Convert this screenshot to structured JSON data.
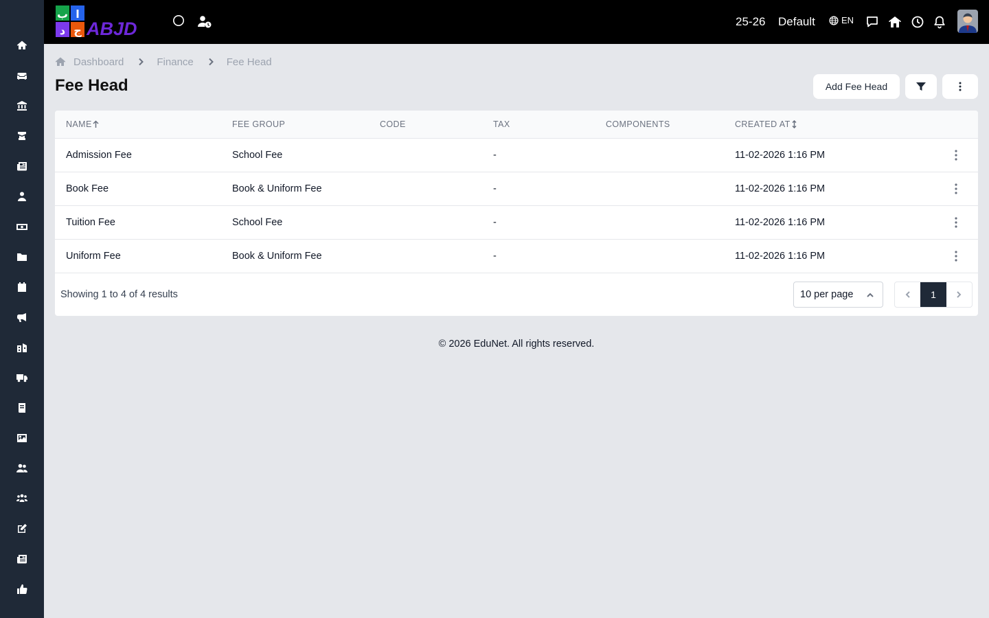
{
  "app": {
    "logo_text": "ABJD"
  },
  "sidebar": {
    "items": [
      {
        "icon": "home-icon",
        "label": "Home"
      },
      {
        "icon": "sofa-icon",
        "label": "Front Office"
      },
      {
        "icon": "bank-icon",
        "label": "Institution"
      },
      {
        "icon": "graduation-icon",
        "label": "Academics"
      },
      {
        "icon": "newspaper-icon",
        "label": "Admissions"
      },
      {
        "icon": "user-icon",
        "label": "Students"
      },
      {
        "icon": "money-icon",
        "label": "Finance"
      },
      {
        "icon": "folder-icon",
        "label": "Documents"
      },
      {
        "icon": "calendar-icon",
        "label": "Calendar"
      },
      {
        "icon": "megaphone-icon",
        "label": "Announcements"
      },
      {
        "icon": "school-icon",
        "label": "School"
      },
      {
        "icon": "truck-icon",
        "label": "Transport"
      },
      {
        "icon": "book-icon",
        "label": "Library"
      },
      {
        "icon": "image-icon",
        "label": "Gallery"
      },
      {
        "icon": "users-icon",
        "label": "Users"
      },
      {
        "icon": "team-icon",
        "label": "Staff"
      },
      {
        "icon": "edit-icon",
        "label": "Exams"
      },
      {
        "icon": "news-icon",
        "label": "News"
      },
      {
        "icon": "thumbs-up-icon",
        "label": "Feedback"
      }
    ]
  },
  "header": {
    "session": "25-26",
    "profile": "Default",
    "language": "EN"
  },
  "breadcrumb": [
    "Dashboard",
    "Finance",
    "Fee Head"
  ],
  "page": {
    "title": "Fee Head",
    "add_button": "Add Fee Head"
  },
  "table": {
    "headers": [
      "NAME",
      "FEE GROUP",
      "CODE",
      "TAX",
      "COMPONENTS",
      "CREATED AT"
    ],
    "rows": [
      {
        "name": "Admission Fee",
        "fee_group": "School Fee",
        "code": "",
        "tax": "-",
        "components": "",
        "created_at": "11-02-2026 1:16 PM"
      },
      {
        "name": "Book Fee",
        "fee_group": "Book & Uniform Fee",
        "code": "",
        "tax": "-",
        "components": "",
        "created_at": "11-02-2026 1:16 PM"
      },
      {
        "name": "Tuition Fee",
        "fee_group": "School Fee",
        "code": "",
        "tax": "-",
        "components": "",
        "created_at": "11-02-2026 1:16 PM"
      },
      {
        "name": "Uniform Fee",
        "fee_group": "Book & Uniform Fee",
        "code": "",
        "tax": "-",
        "components": "",
        "created_at": "11-02-2026 1:16 PM"
      }
    ]
  },
  "pagination": {
    "summary": "Showing 1 to 4 of 4 results",
    "per_page": "10 per page",
    "current_page": "1"
  },
  "footer": "© 2026 EduNet. All rights reserved.",
  "colors": {
    "sidebar": "#1f2937",
    "topbar": "#000000",
    "background": "#e5e7eb",
    "active_page": "#1f2937"
  }
}
